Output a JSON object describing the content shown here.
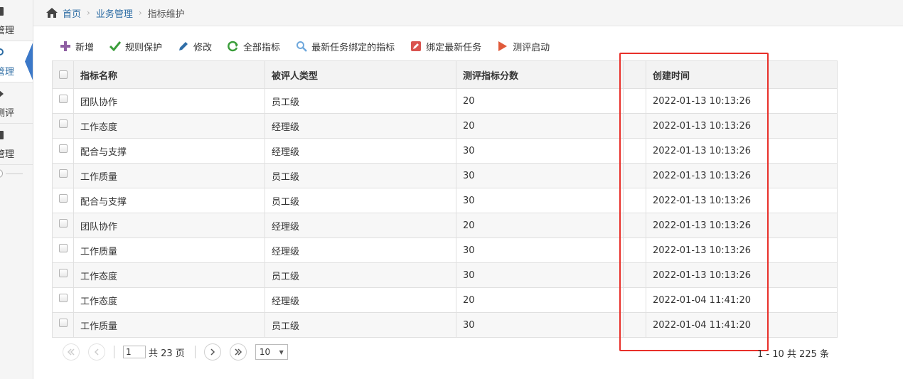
{
  "sidebar": {
    "items": [
      {
        "label": "管理"
      },
      {
        "label": "管理"
      },
      {
        "label": "测评"
      },
      {
        "label": "管理"
      }
    ]
  },
  "breadcrumb": {
    "home": "首页",
    "level1": "业务管理",
    "current": "指标维护"
  },
  "toolbar": {
    "add": "新增",
    "rule_protect": "规则保护",
    "edit": "修改",
    "all_indicators": "全部指标",
    "latest_task_indicators": "最新任务绑定的指标",
    "bind_latest_task": "绑定最新任务",
    "start_evaluation": "测评启动"
  },
  "table": {
    "columns": [
      "指标名称",
      "被评人类型",
      "测评指标分数",
      "",
      "创建时间"
    ],
    "rows": [
      {
        "name": "团队协作",
        "type": "员工级",
        "score": "20",
        "created": "2022-01-13 10:13:26"
      },
      {
        "name": "工作态度",
        "type": "经理级",
        "score": "20",
        "created": "2022-01-13 10:13:26"
      },
      {
        "name": "配合与支撑",
        "type": "经理级",
        "score": "30",
        "created": "2022-01-13 10:13:26"
      },
      {
        "name": "工作质量",
        "type": "员工级",
        "score": "30",
        "created": "2022-01-13 10:13:26"
      },
      {
        "name": "配合与支撑",
        "type": "员工级",
        "score": "30",
        "created": "2022-01-13 10:13:26"
      },
      {
        "name": "团队协作",
        "type": "经理级",
        "score": "20",
        "created": "2022-01-13 10:13:26"
      },
      {
        "name": "工作质量",
        "type": "经理级",
        "score": "30",
        "created": "2022-01-13 10:13:26"
      },
      {
        "name": "工作态度",
        "type": "员工级",
        "score": "30",
        "created": "2022-01-13 10:13:26"
      },
      {
        "name": "工作态度",
        "type": "经理级",
        "score": "20",
        "created": "2022-01-04 11:41:20"
      },
      {
        "name": "工作质量",
        "type": "员工级",
        "score": "30",
        "created": "2022-01-04 11:41:20"
      }
    ]
  },
  "pager": {
    "current_page": "1",
    "total_pages_text": "共 23 页",
    "page_size": "10",
    "info": "1 - 10   共 225 条"
  },
  "colors": {
    "accent": "#2e6da4",
    "highlight": "#e8302a"
  }
}
